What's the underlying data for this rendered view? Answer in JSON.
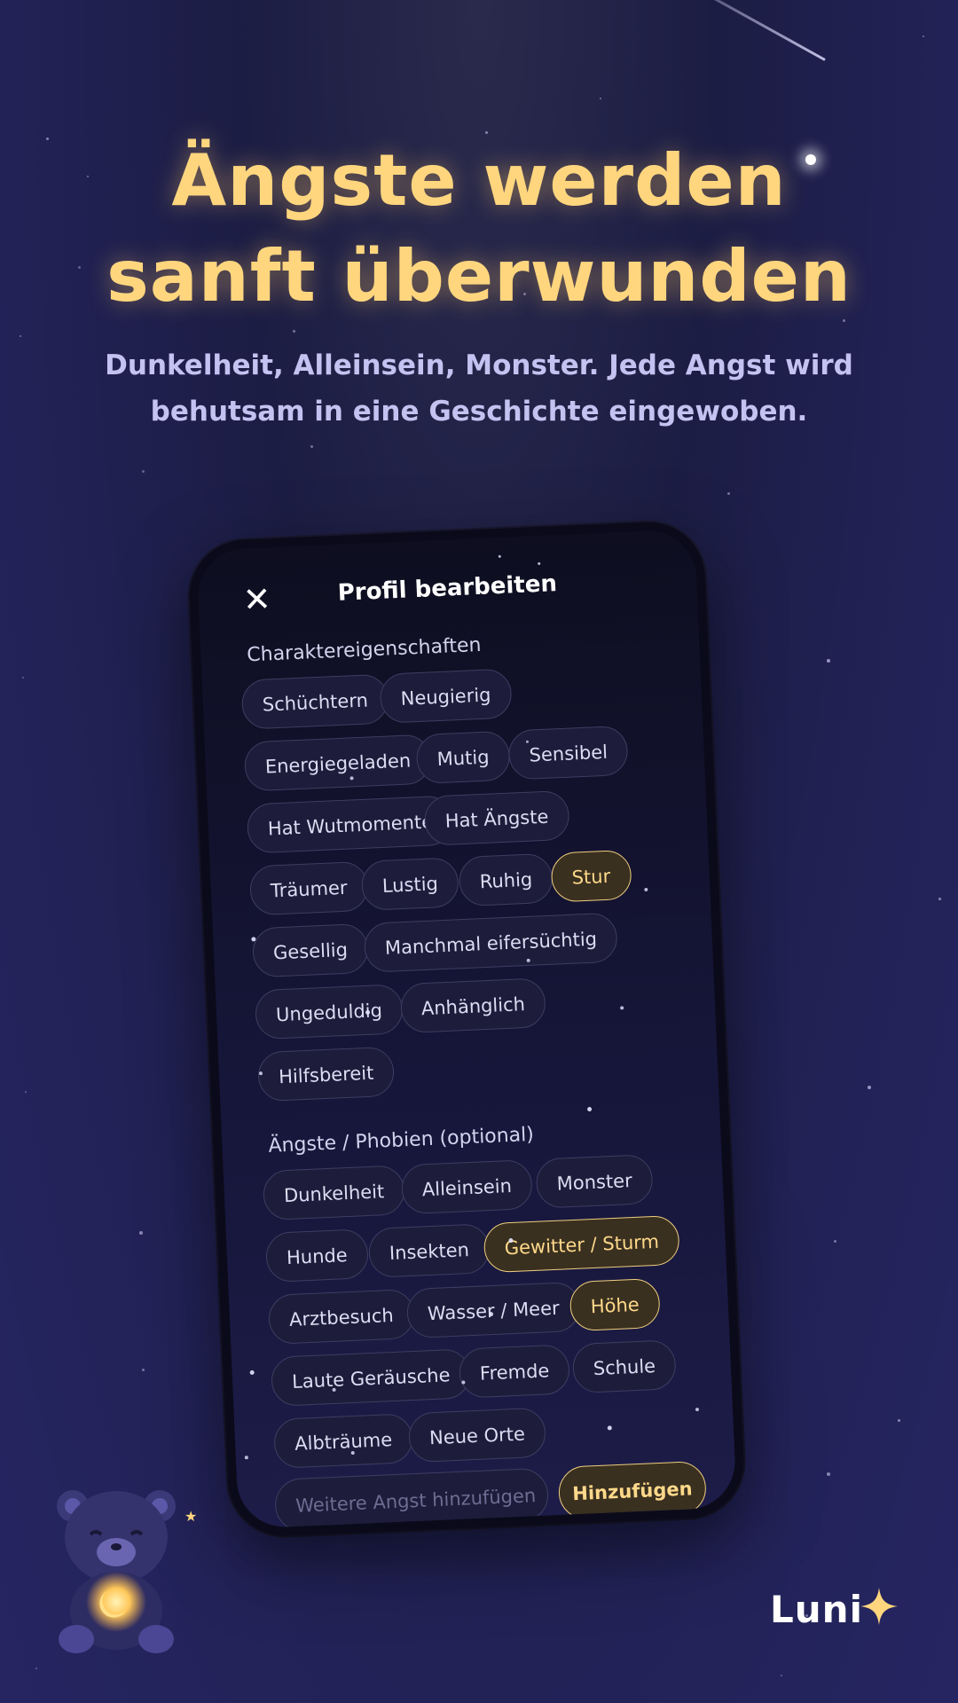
{
  "hero": {
    "headline_line1": "Ängste werden",
    "headline_line2": "sanft überwunden",
    "subline_line1": "Dunkelheit, Alleinsein, Monster. Jede Angst wird",
    "subline_line2": "behutsam in eine Geschichte eingewoben."
  },
  "phone": {
    "close_icon": "close-icon",
    "title": "Profil bearbeiten",
    "traits_section": {
      "label": "Charaktereigenschaften",
      "chips": [
        {
          "label": "Schüchtern",
          "selected": true
        },
        {
          "label": "Neugierig",
          "selected": false
        },
        {
          "label": "Energiegeladen",
          "selected": false
        },
        {
          "label": "Mutig",
          "selected": false
        },
        {
          "label": "Sensibel",
          "selected": false
        },
        {
          "label": "Hat Wutmomente",
          "selected": false
        },
        {
          "label": "Hat Ängste",
          "selected": false
        },
        {
          "label": "Träumer",
          "selected": false
        },
        {
          "label": "Lustig",
          "selected": false
        },
        {
          "label": "Ruhig",
          "selected": false
        },
        {
          "label": "Stur",
          "selected": true
        },
        {
          "label": "Gesellig",
          "selected": false
        },
        {
          "label": "Manchmal eifersüchtig",
          "selected": false
        },
        {
          "label": "Ungeduldig",
          "selected": false
        },
        {
          "label": "Anhänglich",
          "selected": false
        },
        {
          "label": "Hilfsbereit",
          "selected": false
        }
      ]
    },
    "fears_section": {
      "label": "Ängste / Phobien (optional)",
      "chips": [
        {
          "label": "Dunkelheit",
          "selected": false
        },
        {
          "label": "Alleinsein",
          "selected": false
        },
        {
          "label": "Monster",
          "selected": false
        },
        {
          "label": "Hunde",
          "selected": false
        },
        {
          "label": "Insekten",
          "selected": false
        },
        {
          "label": "Gewitter / Sturm",
          "selected": true
        },
        {
          "label": "Arztbesuch",
          "selected": false
        },
        {
          "label": "Wasser / Meer",
          "selected": false
        },
        {
          "label": "Höhe",
          "selected": true
        },
        {
          "label": "Laute Geräusche",
          "selected": false
        },
        {
          "label": "Fremde",
          "selected": false
        },
        {
          "label": "Schule",
          "selected": false
        },
        {
          "label": "Albträume",
          "selected": false
        },
        {
          "label": "Neue Orte",
          "selected": false
        }
      ],
      "add_input_placeholder": "Weitere Angst hinzufügen",
      "add_button_label": "Hinzufügen"
    }
  },
  "branding": {
    "logo_text": "Luni",
    "logo_icon": "sparkle-icon",
    "mascot": "teddy-bear-illustration"
  },
  "colors": {
    "accent_gold": "#ffd67e",
    "background": "#1c1d44",
    "selected_chip_border": "#f0cf7f"
  }
}
